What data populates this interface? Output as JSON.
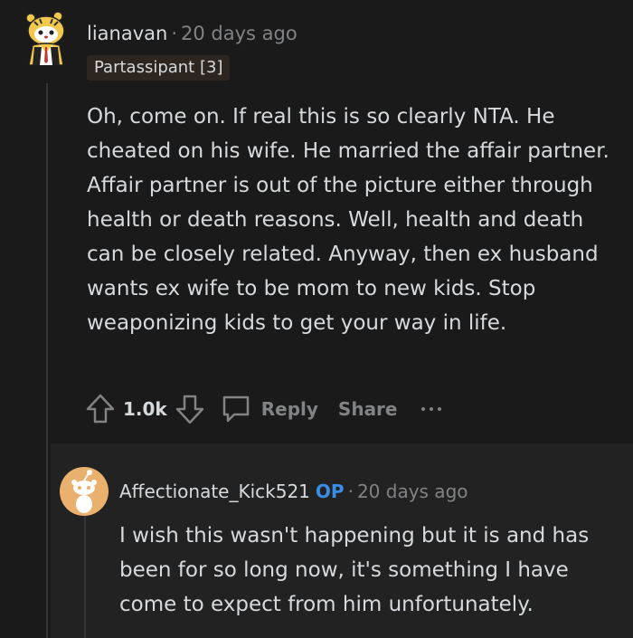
{
  "comment": {
    "username": "lianavan",
    "separator": "·",
    "time": "20 days ago",
    "flair": "Partassipant [3]",
    "body": "Oh, come on. If real this is so clearly NTA. He cheated on his wife. He married the affair partner. Affair partner is out of the picture either through health or death reasons. Well, health and death can be closely related. Anyway, then ex husband wants ex wife to be mom to new kids. Stop weaponizing kids to get your way in life.",
    "score": "1.0k",
    "reply_label": "Reply",
    "share_label": "Share",
    "avatar_icon": "tiger-snoo-avatar-icon"
  },
  "reply": {
    "username": "Affectionate_Kick521",
    "op_badge": "OP",
    "separator": "·",
    "time": "20 days ago",
    "body": "I wish this wasn't happening but it is and has been for so long now, it's something I have come to expect from him unfortunately.",
    "avatar_icon": "default-snoo-avatar-icon"
  },
  "colors": {
    "background": "#1a1a1b",
    "text": "#d7dadc",
    "meta": "#818384",
    "op": "#3a8ee6",
    "reply_avatar": "#e9b06e"
  }
}
